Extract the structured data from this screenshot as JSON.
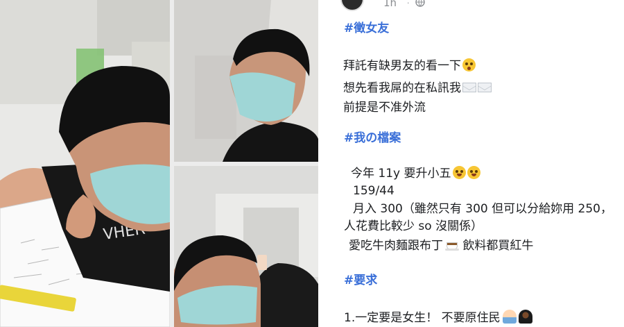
{
  "post": {
    "time": "1h",
    "time_dot": "·",
    "lines": [
      {
        "name": "hashtag-seeking-girlfriend",
        "text": "#徵女友",
        "style": "tag"
      },
      {
        "name": "line-please-look",
        "text": "拜託有缺男友的看一下",
        "emoji": "flushed-face"
      },
      {
        "name": "line-dm-me",
        "text": "想先看我屌的在私訊我",
        "emoji": "envelope-envelope"
      },
      {
        "name": "line-no-leak",
        "text": "前提是不准外流"
      },
      {
        "name": "hashtag-my-profile",
        "text": "#我の檔案",
        "style": "tag"
      },
      {
        "name": "line-age",
        "text": "今年 11y 要升小五",
        "emoji": "grinning-face-x2"
      },
      {
        "name": "line-height-weight",
        "text": "159/44"
      },
      {
        "name": "line-income",
        "text": "月入 300（雖然只有 300 但可以分給妳用 250，"
      },
      {
        "name": "line-income-cont",
        "text": "人花費比較少 so 沒關係）"
      },
      {
        "name": "line-likes",
        "text": "愛吃牛肉麵跟布丁",
        "emoji": "coffee-cup",
        "text2": " 飲料都買紅牛"
      },
      {
        "name": "hashtag-requirements",
        "text": "#要求",
        "style": "tag"
      },
      {
        "name": "line-requirement-1",
        "text": "1.一定要是女生！ 不要原住民",
        "emoji": "man-woman"
      }
    ]
  },
  "photos": [
    {
      "name": "photo-boy-desk",
      "description_icon": "photo"
    },
    {
      "name": "photo-boy-looking-up",
      "description_icon": "photo"
    },
    {
      "name": "photo-boy-selfie",
      "description_icon": "photo"
    }
  ],
  "colors": {
    "hashtag": "#3a6fd8",
    "text": "#1c1e21",
    "meta": "#8a8d91",
    "mask": "#9fd6d6"
  }
}
